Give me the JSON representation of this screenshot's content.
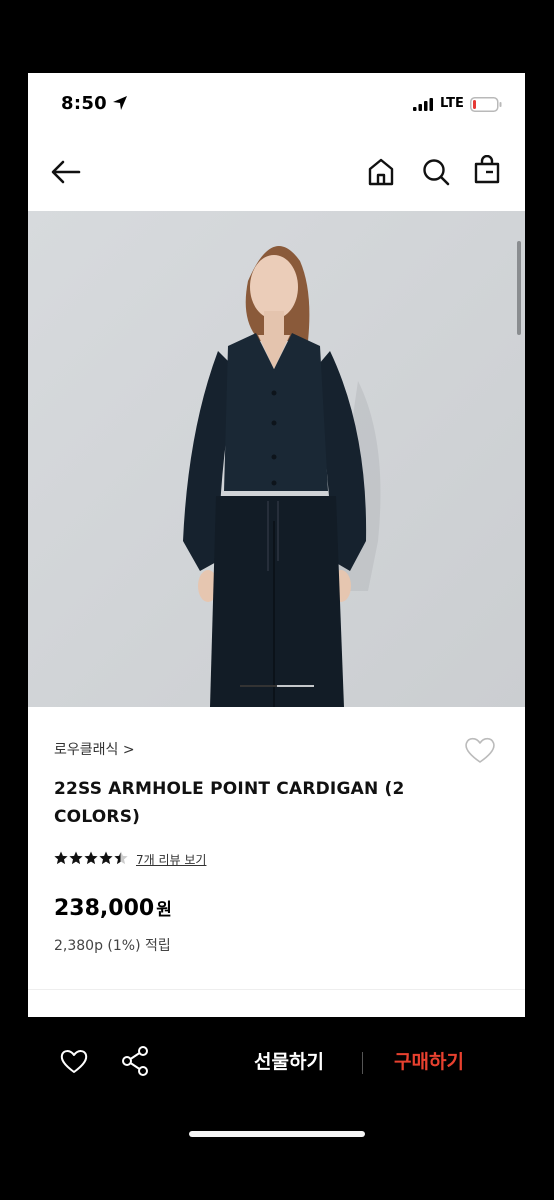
{
  "status_bar": {
    "time": "8:50",
    "network": "LTE"
  },
  "nav": {
    "back_icon": "back-arrow-icon",
    "home_icon": "home-icon",
    "search_icon": "search-icon",
    "cart_icon": "shopping-bag-icon"
  },
  "product": {
    "brand": "로우클래식 >",
    "title": "22SS ARMHOLE POINT CARDIGAN (2 COLORS)",
    "rating": 4.5,
    "review_link": "7개 리뷰 보기",
    "price": "238,000",
    "currency": "원",
    "points": "2,380p (1%) 적립",
    "image_description": "model in navy cardigan"
  },
  "bottom_bar": {
    "gift_label": "선물하기",
    "buy_label": "구매하기",
    "buy_color": "#e8412f"
  }
}
